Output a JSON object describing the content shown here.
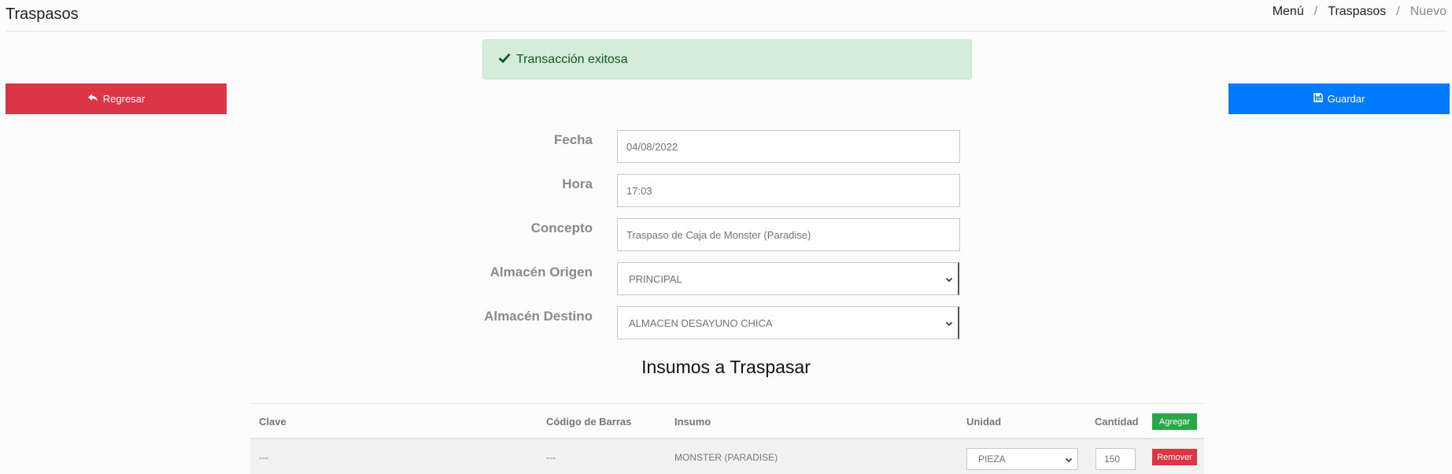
{
  "header": {
    "title": "Traspasos",
    "breadcrumb": [
      {
        "label": "Menú"
      },
      {
        "label": "Traspasos"
      },
      {
        "label": "Nuevo"
      }
    ],
    "separator": "/"
  },
  "alert": {
    "message": "Transacción exitosa",
    "icon": "check-icon"
  },
  "actions": {
    "back_label": "Regresar",
    "save_label": "Guardar"
  },
  "form": {
    "fecha_label": "Fecha",
    "fecha_value": "04/08/2022",
    "hora_label": "Hora",
    "hora_value": "17:03",
    "concepto_label": "Concepto",
    "concepto_value": "Traspaso de Caja de Monster (Paradise)",
    "origen_label": "Almacén Origen",
    "origen_value": "PRINCIPAL",
    "destino_label": "Almacén Destino",
    "destino_value": "ALMACEN DESAYUNO CHICA"
  },
  "section": {
    "title": "Insumos a Traspasar"
  },
  "table": {
    "headers": {
      "clave": "Clave",
      "codigo": "Código de Barras",
      "insumo": "Insumo",
      "unidad": "Unidad",
      "cantidad": "Cantidad",
      "add_label": "Agregar"
    },
    "rows": [
      {
        "clave": "---",
        "codigo": "---",
        "insumo": "MONSTER (PARADISE)",
        "unidad": "PIEZA",
        "cantidad": "150",
        "remove_label": "Remover"
      }
    ]
  },
  "colors": {
    "danger": "#dc3545",
    "primary": "#007bff",
    "success": "#28a745",
    "alert_bg": "#d4edda"
  }
}
